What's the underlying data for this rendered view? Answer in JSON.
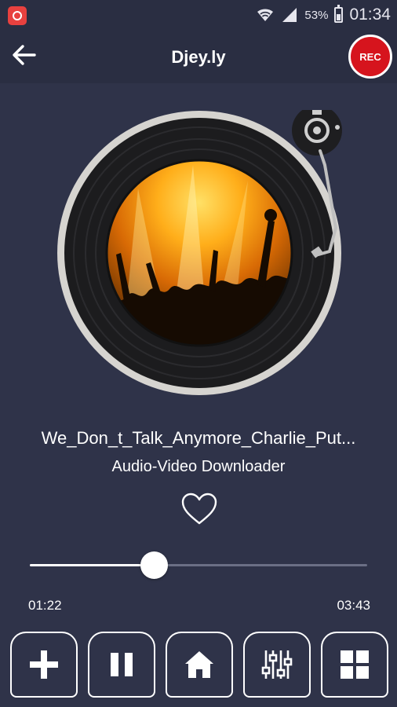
{
  "statusbar": {
    "battery": "53%",
    "time": "01:34",
    "app_icon": "record-app-icon",
    "wifi_icon": "wifi-icon",
    "signal_icon": "signal-icon",
    "battery_icon": "battery-icon"
  },
  "appbar": {
    "title": "Djey.ly",
    "back_icon": "arrow-left-icon",
    "rec_label": "REC"
  },
  "player": {
    "track_title": "We_Don_t_Talk_Anymore_Charlie_Put...",
    "subtitle": "Audio-Video Downloader",
    "like_icon": "heart-outline-icon",
    "elapsed": "01:22",
    "duration": "03:43",
    "progress": 0.367
  },
  "controls": [
    {
      "name": "add-button",
      "icon": "plus-icon"
    },
    {
      "name": "pause-button",
      "icon": "pause-icon"
    },
    {
      "name": "home-button",
      "icon": "home-icon"
    },
    {
      "name": "equalizer-button",
      "icon": "equalizer-icon"
    },
    {
      "name": "grid-menu-button",
      "icon": "grid-icon"
    }
  ],
  "colors": {
    "background": "#2f3349",
    "bar": "#2a2e42",
    "rec_red": "#d6141d",
    "accent_white": "#ffffff"
  }
}
